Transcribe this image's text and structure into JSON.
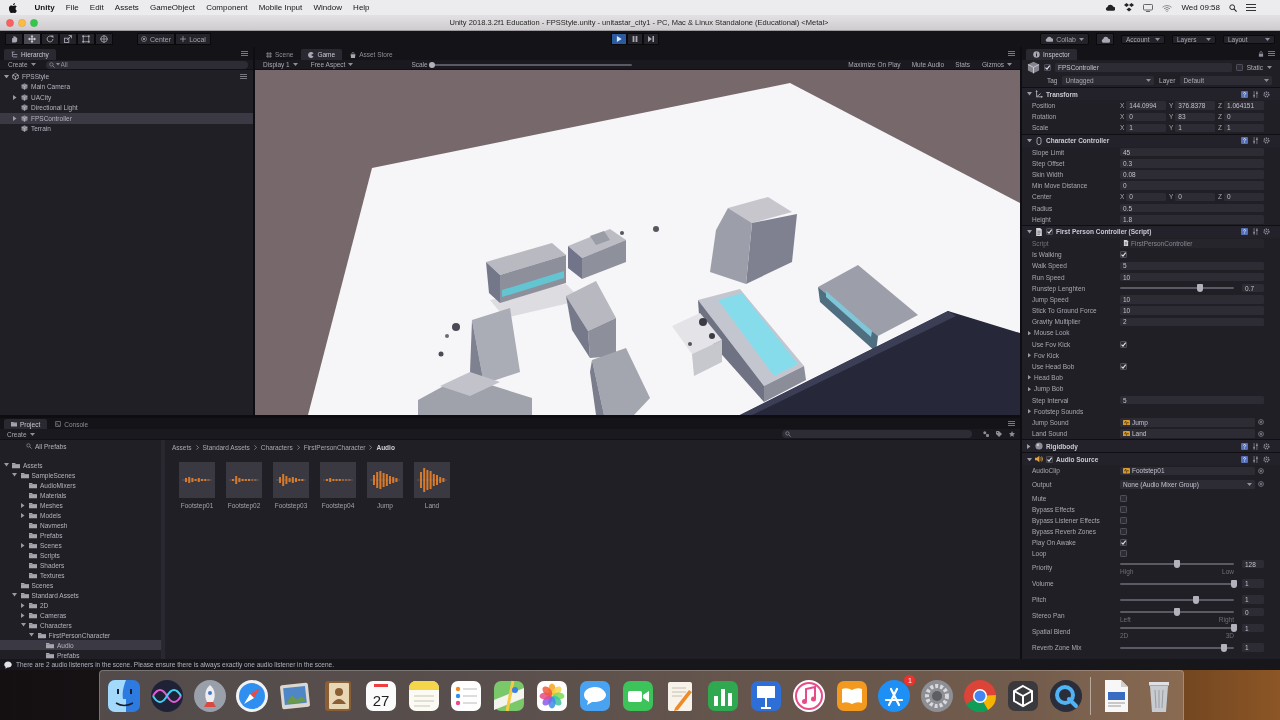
{
  "menu_bar": {
    "items": [
      {
        "label": "Unity"
      },
      {
        "label": "File"
      },
      {
        "label": "Edit"
      },
      {
        "label": "Assets"
      },
      {
        "label": "GameObject"
      },
      {
        "label": "Component"
      },
      {
        "label": "Mobile Input"
      },
      {
        "label": "Window"
      },
      {
        "label": "Help"
      }
    ],
    "clock": "Wed 09:58"
  },
  "window": {
    "title": "Unity 2018.3.2f1 Education - FPSStyle.unity - unitastar_city1 - PC, Mac & Linux Standalone (Educational) <Metal>"
  },
  "toolbar": {
    "tools": [
      {
        "kind": "hand",
        "selected": false
      },
      {
        "kind": "move",
        "selected": true
      },
      {
        "kind": "rotate",
        "selected": false
      },
      {
        "kind": "scale",
        "selected": false
      },
      {
        "kind": "rect",
        "selected": false
      },
      {
        "kind": "transform",
        "selected": false
      }
    ],
    "pivot": "Center",
    "space": "Local",
    "play_controls": [
      {
        "kind": "play",
        "selected": true
      },
      {
        "kind": "pause",
        "selected": false
      },
      {
        "kind": "step",
        "selected": false
      }
    ],
    "collab": "Collab",
    "account": "Account",
    "layers": "Layers",
    "layout": "Layout"
  },
  "hierarchy": {
    "tab": "Hierarchy",
    "create": "Create",
    "search": {
      "placeholder": "All"
    },
    "tree": [
      {
        "label": "FPSStyle",
        "expanded": true,
        "selected": false,
        "children": [
          {
            "label": "Main Camera",
            "selected": false
          },
          {
            "label": "UACity",
            "expanded": false,
            "selected": false
          },
          {
            "label": "Directional Light",
            "selected": false
          },
          {
            "label": "FPSController",
            "expanded": false,
            "selected": true
          },
          {
            "label": "Terrain",
            "selected": false
          }
        ]
      }
    ]
  },
  "game_view": {
    "tabs": [
      {
        "kind": "scene",
        "label": "Scene",
        "selected": false
      },
      {
        "kind": "game",
        "label": "Game",
        "selected": true
      },
      {
        "kind": "store",
        "label": "Asset Store",
        "selected": false
      }
    ],
    "display": "Display 1",
    "aspect": "Free Aspect",
    "scale": {
      "label": "Scale",
      "level": 0
    },
    "toggles": [
      {
        "label": "Maximize On Play",
        "on": false
      },
      {
        "label": "Mute Audio",
        "on": false
      },
      {
        "label": "Stats",
        "on": false
      }
    ],
    "gizmos": "Gizmos"
  },
  "inspector": {
    "tab": "Inspector",
    "object": {
      "name": "FPSController",
      "active": true,
      "static_label": "Static",
      "static": false,
      "tag_label": "Tag",
      "tag": "Untagged",
      "layer_label": "Layer",
      "layer": "Default"
    },
    "components": [
      {
        "kind": "transform",
        "name": "Transform",
        "expanded": true,
        "properties": [
          {
            "kind": "vector3",
            "label": "Position",
            "axes": [
              {
                "axis": "X",
                "value": "144.0994"
              },
              {
                "axis": "Y",
                "value": "376.8378"
              },
              {
                "axis": "Z",
                "value": "1.064151"
              }
            ]
          },
          {
            "kind": "vector3",
            "label": "Rotation",
            "axes": [
              {
                "axis": "X",
                "value": "0"
              },
              {
                "axis": "Y",
                "value": "83"
              },
              {
                "axis": "Z",
                "value": "0"
              }
            ]
          },
          {
            "kind": "vector3",
            "label": "Scale",
            "axes": [
              {
                "axis": "X",
                "value": "1"
              },
              {
                "axis": "Y",
                "value": "1"
              },
              {
                "axis": "Z",
                "value": "1"
              }
            ]
          }
        ]
      },
      {
        "kind": "collider",
        "name": "Character Controller",
        "expanded": true,
        "properties": [
          {
            "kind": "number",
            "label": "Slope Limit",
            "value": "45"
          },
          {
            "kind": "number",
            "label": "Step Offset",
            "value": "0.3"
          },
          {
            "kind": "number",
            "label": "Skin Width",
            "value": "0.08"
          },
          {
            "kind": "number",
            "label": "Min Move Distance",
            "value": "0"
          },
          {
            "kind": "vector3",
            "label": "Center",
            "axes": [
              {
                "axis": "X",
                "value": "0"
              },
              {
                "axis": "Y",
                "value": "0"
              },
              {
                "axis": "Z",
                "value": "0"
              }
            ]
          },
          {
            "kind": "number",
            "label": "Radius",
            "value": "0.5"
          },
          {
            "kind": "number",
            "label": "Height",
            "value": "1.8"
          }
        ]
      },
      {
        "kind": "script",
        "name": "First Person Controller (Script)",
        "expanded": true,
        "enabled": true,
        "properties": [
          {
            "kind": "script",
            "label": "Script",
            "value": "FirstPersonController"
          },
          {
            "kind": "checkbox",
            "label": "Is Walking",
            "checked": true
          },
          {
            "kind": "number",
            "label": "Walk Speed",
            "value": "5"
          },
          {
            "kind": "number",
            "label": "Run Speed",
            "value": "10"
          },
          {
            "kind": "slider",
            "label": "Runstep Lenghten",
            "level": 0.7,
            "value": "0.7"
          },
          {
            "kind": "number",
            "label": "Jump Speed",
            "value": "10"
          },
          {
            "kind": "number",
            "label": "Stick To Ground Force",
            "value": "10"
          },
          {
            "kind": "number",
            "label": "Gravity Multiplier",
            "value": "2"
          },
          {
            "kind": "foldout",
            "label": "Mouse Look",
            "expanded": false
          },
          {
            "kind": "checkbox",
            "label": "Use Fov Kick",
            "checked": true
          },
          {
            "kind": "foldout",
            "label": "Fov Kick",
            "expanded": false
          },
          {
            "kind": "checkbox",
            "label": "Use Head Bob",
            "checked": true
          },
          {
            "kind": "foldout",
            "label": "Head Bob",
            "expanded": false
          },
          {
            "kind": "foldout",
            "label": "Jump Bob",
            "expanded": false
          },
          {
            "kind": "number",
            "label": "Step Interval",
            "value": "5"
          },
          {
            "kind": "foldout",
            "label": "Footstep Sounds",
            "expanded": false
          },
          {
            "kind": "audio",
            "label": "Jump Sound",
            "value": "Jump"
          },
          {
            "kind": "audio",
            "label": "Land Sound",
            "value": "Land"
          }
        ]
      },
      {
        "kind": "rigidbody",
        "name": "Rigidbody",
        "expanded": false
      },
      {
        "kind": "audio",
        "name": "Audio Source",
        "expanded": true,
        "enabled": true,
        "properties": [
          {
            "kind": "audio",
            "label": "AudioClip",
            "value": "Footstep01"
          },
          {
            "kind": "dropdown",
            "label": "Output",
            "value": "None (Audio Mixer Group)"
          },
          {
            "kind": "checkbox",
            "label": "Mute",
            "checked": false
          },
          {
            "kind": "checkbox",
            "label": "Bypass Effects",
            "checked": false
          },
          {
            "kind": "checkbox",
            "label": "Bypass Listener Effects",
            "checked": false
          },
          {
            "kind": "checkbox",
            "label": "Bypass Reverb Zones",
            "checked": false
          },
          {
            "kind": "checkbox",
            "label": "Play On Awake",
            "checked": true
          },
          {
            "kind": "checkbox",
            "label": "Loop",
            "checked": false
          },
          {
            "kind": "range",
            "label": "Priority",
            "level": 0.5,
            "value": "128",
            "min_label": "High",
            "max_label": "Low"
          },
          {
            "kind": "range",
            "label": "Volume",
            "level": 1,
            "value": "1"
          },
          {
            "kind": "range",
            "label": "Pitch",
            "level": 0.67,
            "value": "1"
          },
          {
            "kind": "range",
            "label": "Stereo Pan",
            "level": 0.5,
            "value": "0",
            "min_label": "Left",
            "max_label": "Right"
          },
          {
            "kind": "range",
            "label": "Spatial Blend",
            "level": 1,
            "value": "1",
            "min_label": "2D",
            "max_label": "3D"
          },
          {
            "kind": "range",
            "label": "Reverb Zone Mix",
            "level": 0.91,
            "value": "1"
          }
        ]
      }
    ]
  },
  "project": {
    "tabs": [
      {
        "kind": "project",
        "label": "Project",
        "selected": true
      },
      {
        "kind": "console",
        "label": "Console",
        "selected": false
      }
    ],
    "create": "Create",
    "favorites": [
      {
        "label": "All Prefabs",
        "selected": false
      }
    ],
    "tree": [
      {
        "label": "Assets",
        "expanded": true,
        "selected": false,
        "children": [
          {
            "label": "SampleScenes",
            "expanded": true,
            "selected": false,
            "children": [
              {
                "label": "AudioMixers",
                "selected": false
              },
              {
                "label": "Materials",
                "selected": false
              },
              {
                "label": "Meshes",
                "expanded": false,
                "selected": false
              },
              {
                "label": "Models",
                "expanded": false,
                "selected": false
              },
              {
                "label": "Navmesh",
                "selected": false
              },
              {
                "label": "Prefabs",
                "selected": false
              },
              {
                "label": "Scenes",
                "expanded": false,
                "selected": false
              },
              {
                "label": "Scripts",
                "selected": false
              },
              {
                "label": "Shaders",
                "selected": false
              },
              {
                "label": "Textures",
                "selected": false
              }
            ]
          },
          {
            "label": "Scenes",
            "selected": false
          },
          {
            "label": "Standard Assets",
            "expanded": true,
            "selected": false,
            "children": [
              {
                "label": "2D",
                "expanded": false,
                "selected": false
              },
              {
                "label": "Cameras",
                "expanded": false,
                "selected": false
              },
              {
                "label": "Characters",
                "expanded": true,
                "selected": false,
                "children": [
                  {
                    "label": "FirstPersonCharacter",
                    "expanded": true,
                    "selected": false,
                    "children": [
                      {
                        "label": "Audio",
                        "selected": true
                      },
                      {
                        "label": "Prefabs",
                        "selected": false
                      }
                    ]
                  }
                ]
              }
            ]
          }
        ]
      }
    ],
    "breadcrumb": [
      "Assets",
      "Standard Assets",
      "Characters",
      "FirstPersonCharacter",
      "Audio"
    ],
    "assets": [
      {
        "label": "Footstep01",
        "selected": false
      },
      {
        "label": "Footstep02",
        "selected": false
      },
      {
        "label": "Footstep03",
        "selected": false
      },
      {
        "label": "Footstep04",
        "selected": false
      },
      {
        "label": "Jump",
        "selected": false
      },
      {
        "label": "Land",
        "selected": false
      }
    ]
  },
  "status_bar": {
    "kind": "info",
    "message": "There are 2 audio listeners in the scene. Please ensure there is always exactly one audio listener in the scene."
  },
  "dock": {
    "items": [
      {
        "kind": "finder"
      },
      {
        "kind": "siri"
      },
      {
        "kind": "launchpad"
      },
      {
        "kind": "safari"
      },
      {
        "kind": "preview"
      },
      {
        "kind": "contacts"
      },
      {
        "kind": "calendar",
        "text": "27"
      },
      {
        "kind": "notes"
      },
      {
        "kind": "reminders"
      },
      {
        "kind": "maps"
      },
      {
        "kind": "photos"
      },
      {
        "kind": "messages"
      },
      {
        "kind": "facetime"
      },
      {
        "kind": "pages"
      },
      {
        "kind": "numbers"
      },
      {
        "kind": "keynote"
      },
      {
        "kind": "music"
      },
      {
        "kind": "books"
      },
      {
        "kind": "store",
        "badge": "1"
      },
      {
        "kind": "settings"
      },
      {
        "kind": "chrome"
      },
      {
        "kind": "unity"
      },
      {
        "kind": "quicktime"
      },
      {
        "kind": "document"
      },
      {
        "kind": "trash"
      }
    ]
  }
}
